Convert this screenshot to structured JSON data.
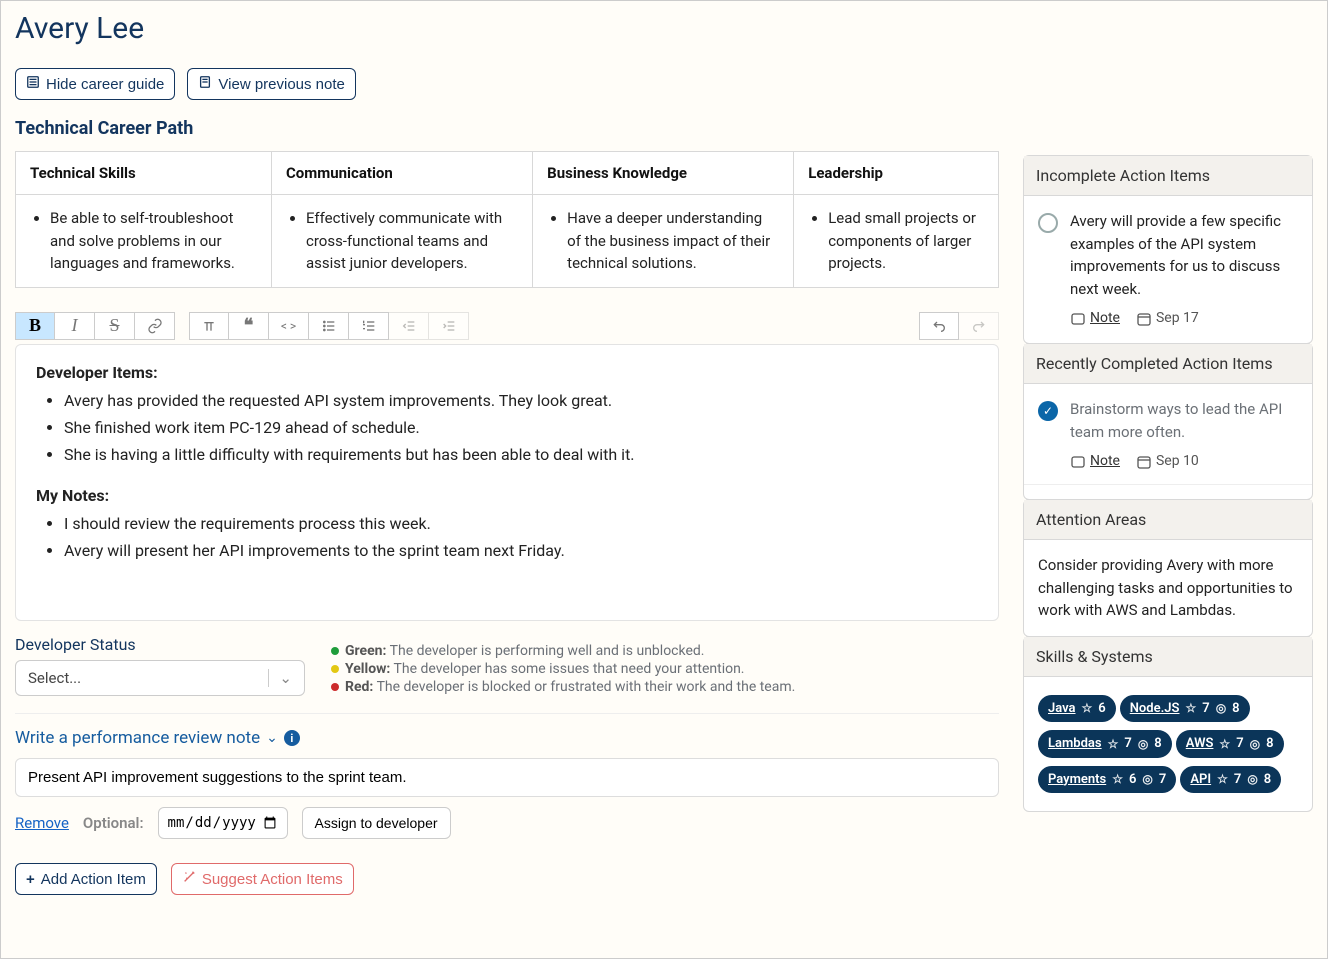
{
  "header": {
    "title": "Avery Lee"
  },
  "buttons": {
    "hide_guide": "Hide career guide",
    "view_prev": "View previous note",
    "add_action": "Add Action Item",
    "suggest": "Suggest Action Items",
    "assign": "Assign to developer"
  },
  "career": {
    "title": "Technical Career Path",
    "cols": [
      {
        "h": "Technical Skills",
        "item": "Be able to self-troubleshoot and solve problems in our languages and frameworks."
      },
      {
        "h": "Communication",
        "item": "Effectively communicate with cross-functional teams and assist junior developers."
      },
      {
        "h": "Business Knowledge",
        "item": "Have a deeper understanding of the business impact of their technical solutions."
      },
      {
        "h": "Leadership",
        "item": "Lead small projects or components of larger projects."
      }
    ]
  },
  "toolbar": {
    "bold": "B",
    "italic": "I",
    "strike": "S",
    "link": "🔗",
    "heading": "T",
    "quote": "❝",
    "code": "< >",
    "ul": "≣",
    "ol": "≡",
    "out": "⇤",
    "in": "⇥",
    "undo": "↶",
    "redo": "↷"
  },
  "note": {
    "s1_title": "Developer Items:",
    "s1_items": [
      "Avery has provided the requested API system improvements. They look great.",
      "She finished work item PC-129 ahead of schedule.",
      "She is having a little difficulty with requirements but has been able to deal with it."
    ],
    "s2_title": "My Notes:",
    "s2_items": [
      "I should review the requirements process this week.",
      "Avery will present her API improvements to the sprint team next Friday."
    ]
  },
  "status": {
    "label": "Developer Status",
    "placeholder": "Select...",
    "legend": {
      "green_l": "Green:",
      "green_t": "The developer is performing well and is unblocked.",
      "yellow_l": "Yellow:",
      "yellow_t": "The developer has some issues that need your attention.",
      "red_l": "Red:",
      "red_t": "The developer is blocked or frustrated with their work and the team."
    }
  },
  "review": {
    "heading": "Write a performance review note",
    "action_text": "Present API improvement suggestions to the sprint team.",
    "remove": "Remove",
    "optional": "Optional:",
    "date_ph": "mm/dd/yyyy"
  },
  "side": {
    "incomplete_h": "Incomplete Action Items",
    "incomplete_items": [
      {
        "text": "Avery will provide a few specific examples of the API system improvements for us to discuss next week.",
        "note": "Note",
        "date": "Sep 17"
      }
    ],
    "done_h": "Recently Completed Action Items",
    "done_items": [
      {
        "text": "Brainstorm ways to lead the API team more often.",
        "note": "Note",
        "date": "Sep 10"
      }
    ],
    "attention_h": "Attention Areas",
    "attention_t": "Consider providing Avery with more challenging tasks and opportunities to work with AWS and Lambdas.",
    "skills_h": "Skills & Systems",
    "skills": [
      {
        "name": "Java",
        "star": "6",
        "target": null
      },
      {
        "name": "Node.JS",
        "star": "7",
        "target": "8"
      },
      {
        "name": "Lambdas",
        "star": "7",
        "target": "8"
      },
      {
        "name": "AWS",
        "star": "7",
        "target": "8"
      },
      {
        "name": "Payments",
        "star": "6",
        "target": "7"
      },
      {
        "name": "API",
        "star": "7",
        "target": "8"
      }
    ]
  }
}
